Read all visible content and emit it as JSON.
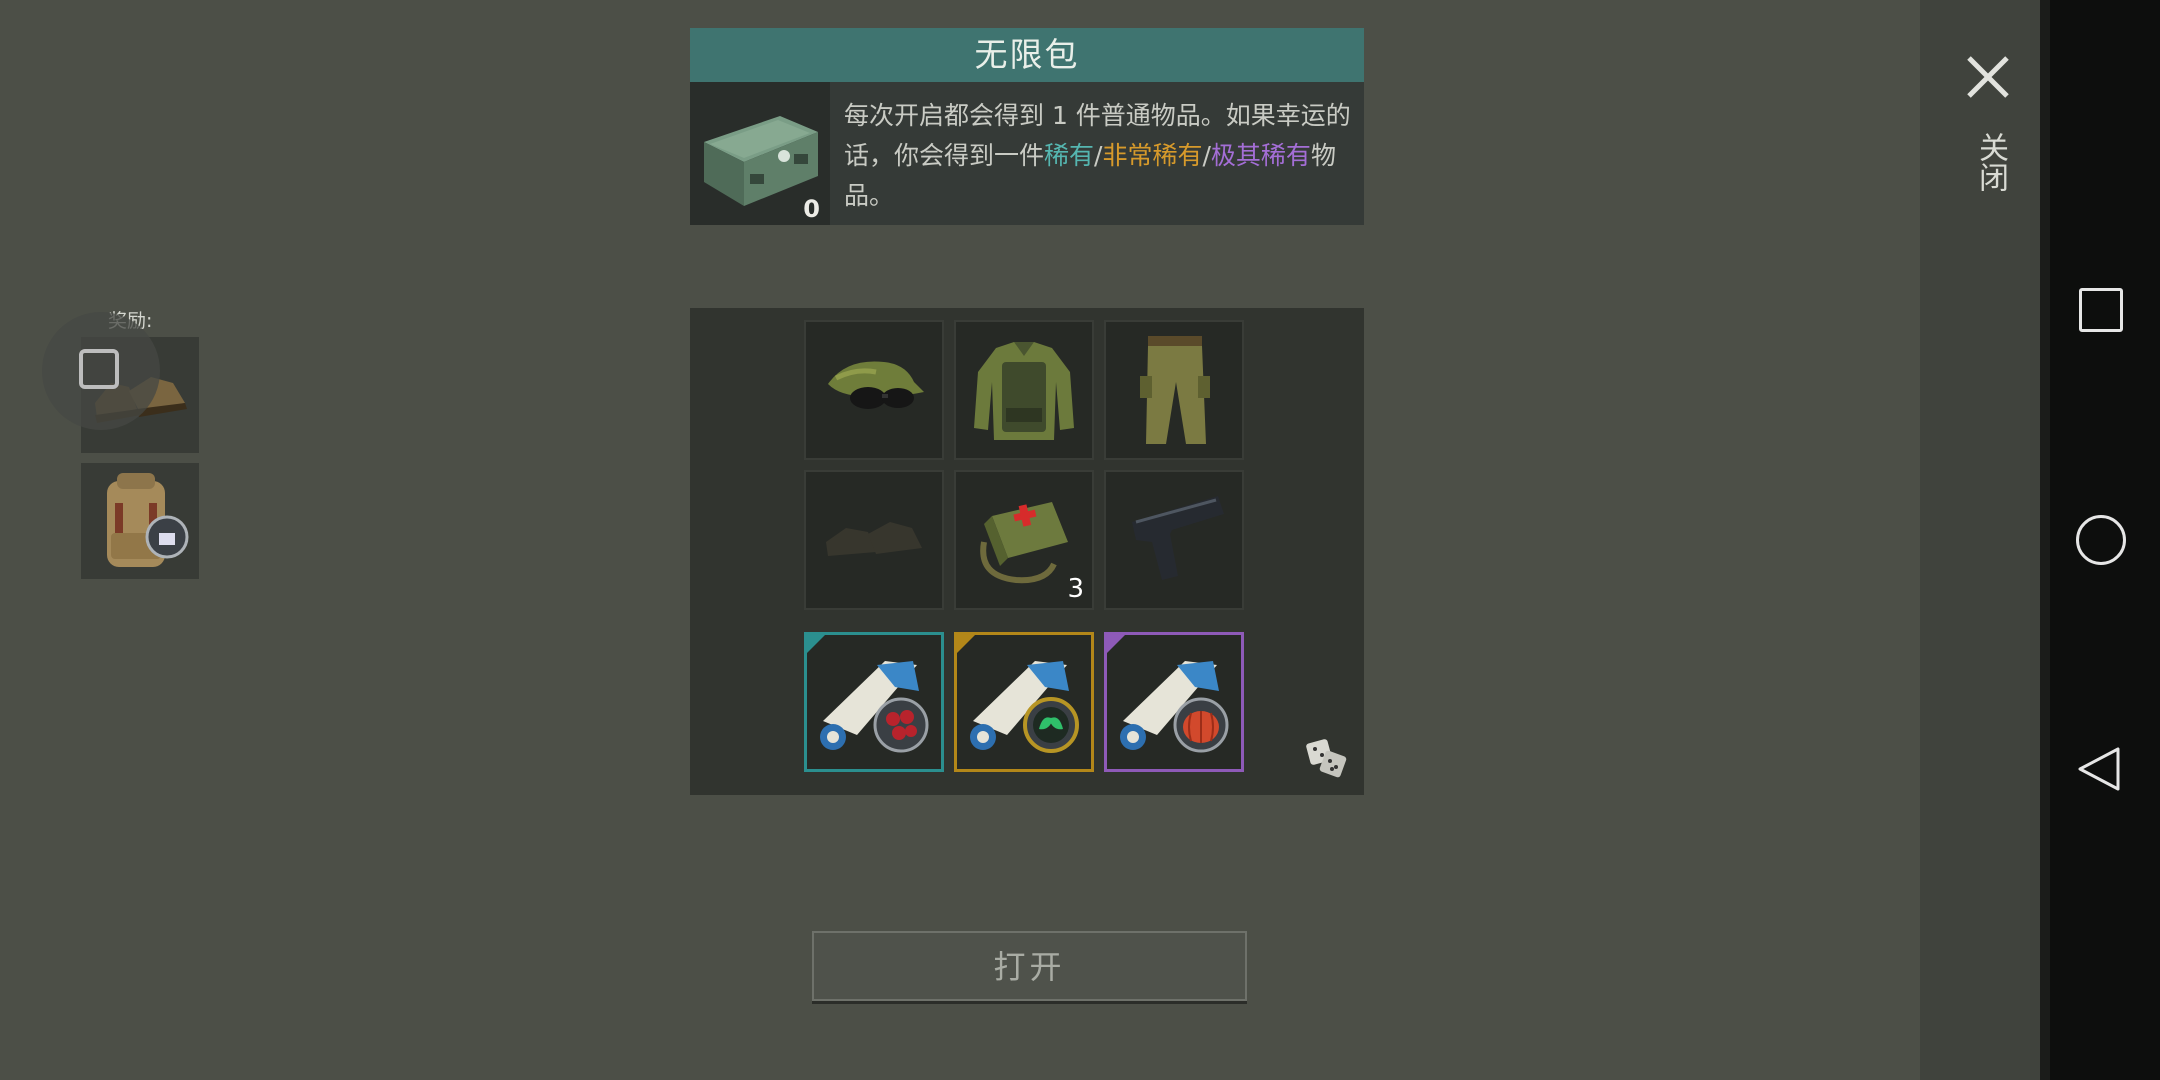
{
  "header": {
    "title": "无限包",
    "count": "0",
    "desc_part1": "每次开启都会得到 1 件普通物品。如果幸运的话，你会得到一件",
    "rare": "稀有",
    "sep1": "/",
    "very_rare": "非常稀有",
    "sep2": "/",
    "extremely_rare": "极其稀有",
    "desc_end": "物品。"
  },
  "loot": {
    "items": [
      {
        "icon": "camo-cap-with-goggles-icon",
        "qty": ""
      },
      {
        "icon": "camo-tactical-jacket-icon",
        "qty": ""
      },
      {
        "icon": "camo-pants-icon",
        "qty": ""
      },
      {
        "icon": "boots-icon",
        "qty": ""
      },
      {
        "icon": "medkit-bag-icon",
        "qty": "3"
      },
      {
        "icon": "pistol-icon",
        "qty": ""
      },
      {
        "icon": "recipe-scroll-berries-icon",
        "qty": "",
        "rarity": "rare"
      },
      {
        "icon": "recipe-scroll-leaves-icon",
        "qty": "",
        "rarity": "very-rare"
      },
      {
        "icon": "recipe-scroll-pumpkin-icon",
        "qty": "",
        "rarity": "extremely-rare"
      }
    ],
    "dice_icon": "dice-icon"
  },
  "rewards": {
    "label": "奖励:",
    "items": [
      "boots-icon",
      "backpack-icon"
    ]
  },
  "open_button": "打开",
  "close": {
    "label": "关闭",
    "icon": "close-icon"
  },
  "colors": {
    "background": "#4c4f47",
    "title_bar": "#3f7470",
    "rare": "#55b6b0",
    "very_rare": "#d79a2b",
    "extremely_rare": "#a46ed6"
  },
  "system_nav": [
    "recent-apps-icon",
    "home-icon",
    "back-icon"
  ]
}
